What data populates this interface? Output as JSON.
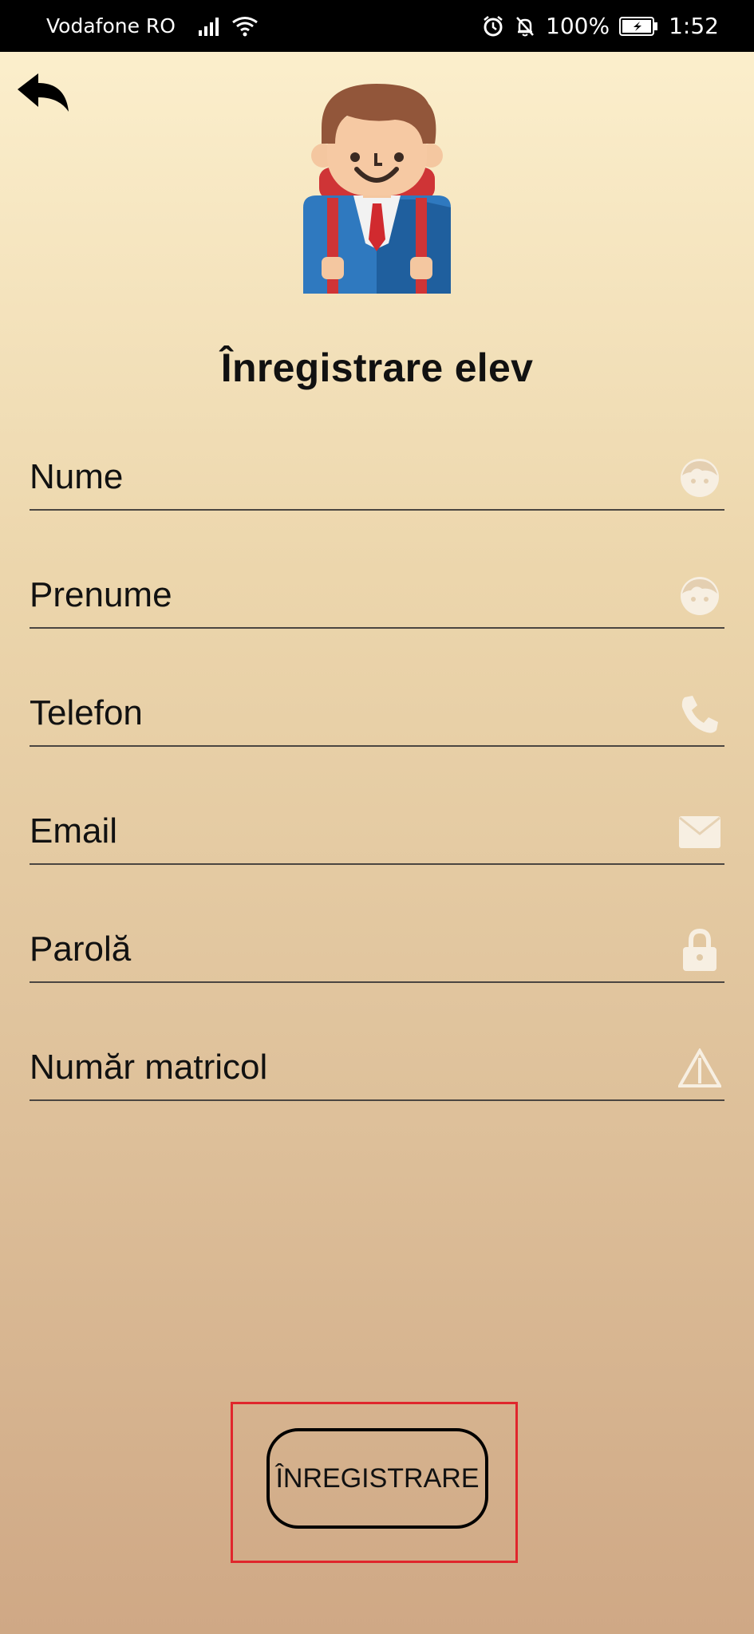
{
  "status_bar": {
    "carrier": "Vodafone RO",
    "battery": "100%",
    "time": "1:52"
  },
  "icons": {
    "back": "back-arrow-icon",
    "avatar": "student-avatar-icon",
    "face": "face-icon",
    "phone": "phone-icon",
    "email": "envelope-icon",
    "lock": "lock-icon",
    "warning": "warning-icon"
  },
  "colors": {
    "highlight_frame": "#e0262c",
    "field_icon": "#f7efe2"
  },
  "page": {
    "title": "Înregistrare elev"
  },
  "form": {
    "fields": [
      {
        "placeholder": "Nume",
        "value": ""
      },
      {
        "placeholder": "Prenume",
        "value": ""
      },
      {
        "placeholder": "Telefon",
        "value": ""
      },
      {
        "placeholder": "Email",
        "value": ""
      },
      {
        "placeholder": "Parolă",
        "value": ""
      },
      {
        "placeholder": "Număr matricol",
        "value": ""
      }
    ],
    "submit_label": "ÎNREGISTRARE"
  }
}
